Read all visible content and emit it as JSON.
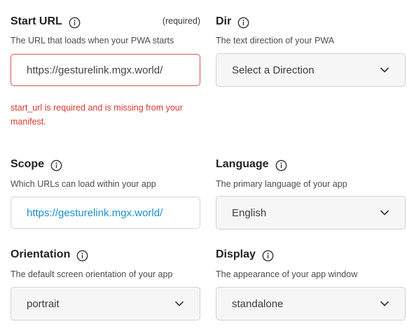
{
  "start_url": {
    "label": "Start URL",
    "required": "(required)",
    "description": "The URL that loads when your PWA starts",
    "value": "https://gesturelink.mgx.world/",
    "error": "start_url is required and is missing from your manifest."
  },
  "dir": {
    "label": "Dir",
    "description": "The text direction of your PWA",
    "selected": "Select a Direction"
  },
  "scope": {
    "label": "Scope",
    "description": "Which URLs can load within your app",
    "value": "https://gesturelink.mgx.world/"
  },
  "language": {
    "label": "Language",
    "description": "The primary language of your app",
    "selected": "English"
  },
  "orientation": {
    "label": "Orientation",
    "description": "The default screen orientation of your app",
    "selected": "portrait"
  },
  "display": {
    "label": "Display",
    "description": "The appearance of your app window",
    "selected": "standalone"
  },
  "colors": {
    "error": "#d9362f",
    "link": "#1a8fcf"
  },
  "icons": {
    "info": "info-icon",
    "dropdown": "chevron-down-icon"
  }
}
